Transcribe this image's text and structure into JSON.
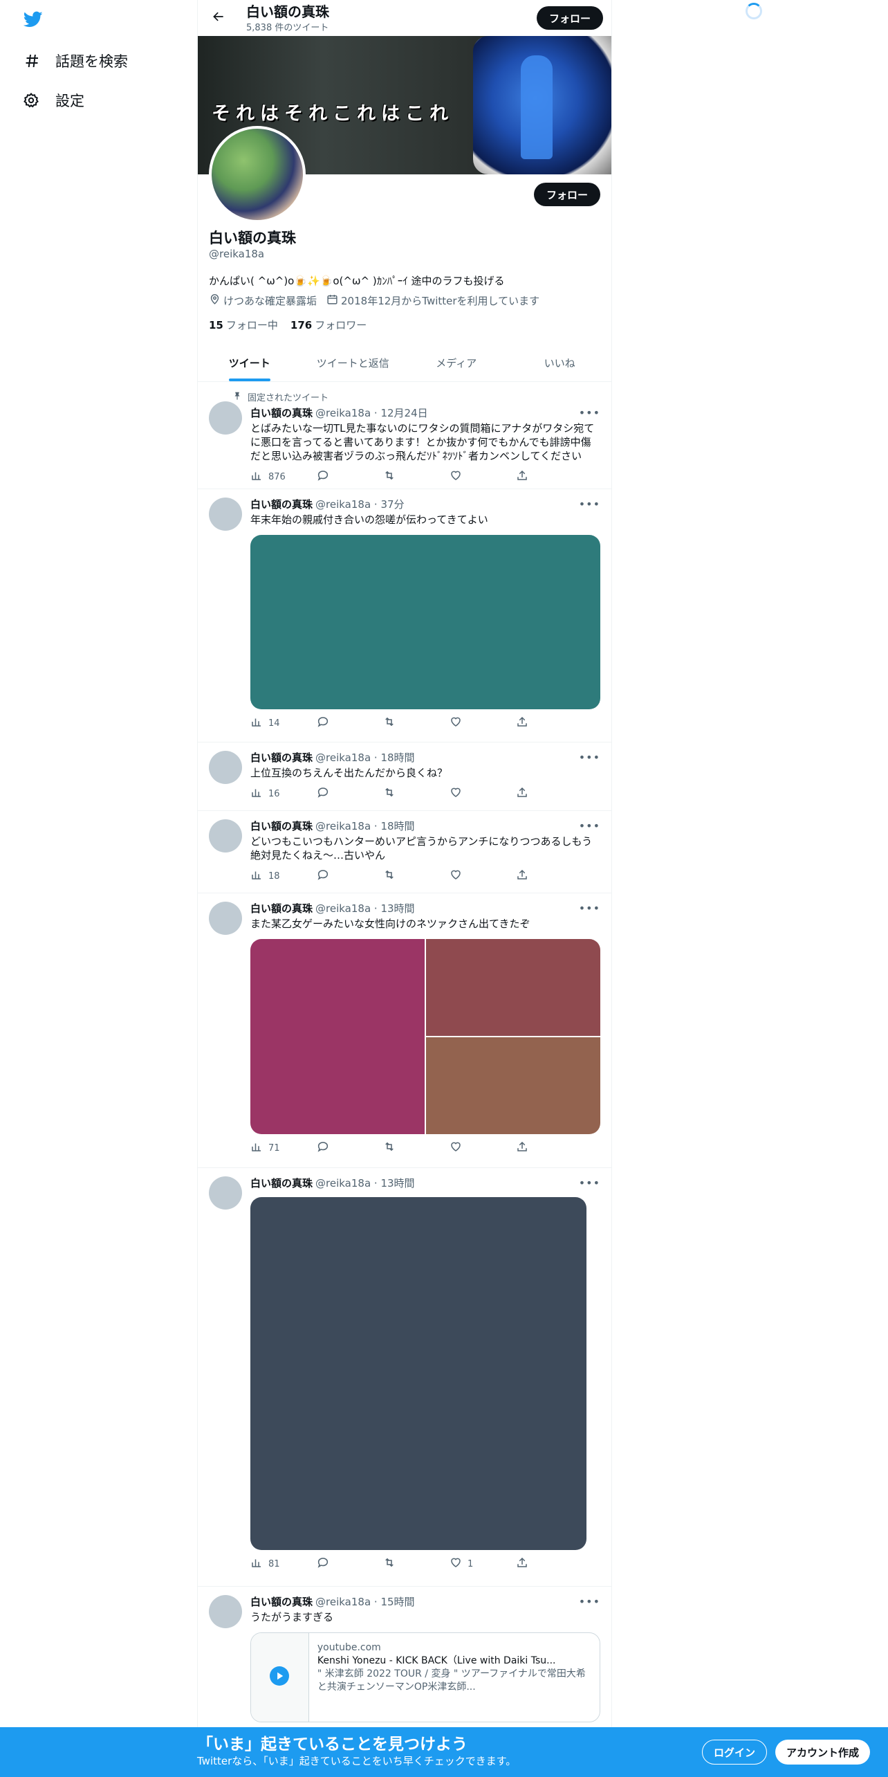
{
  "nav": {
    "items": [
      {
        "label": "話題を検索",
        "icon": "hashtag-icon"
      },
      {
        "label": "設定",
        "icon": "gear-icon"
      }
    ]
  },
  "header": {
    "name": "白い額の真珠",
    "tweet_count": "5,838 件のツイート",
    "follow_label": "フォロー"
  },
  "banner": {
    "text": "それはそれこれはこれ"
  },
  "profile": {
    "name": "白い額の真珠",
    "handle": "@reika18a",
    "bio": "かんぱい( ^ω^)o🍺✨🍺o(^ω^ )ｶﾝﾊﾟｰｲ 途中のラフも投げる",
    "location": "けつあな確定暴露垢",
    "joined": "2018年12月からTwitterを利用しています",
    "following_count": "15",
    "following_label": "フォロー中",
    "followers_count": "176",
    "followers_label": "フォロワー",
    "follow_label": "フォロー"
  },
  "tabs": [
    "ツイート",
    "ツイートと返信",
    "メディア",
    "いいね"
  ],
  "tweets": [
    {
      "pinned_label": "固定されたツイート",
      "name": "白い額の真珠",
      "handle": "@reika18a",
      "time": "12月24日",
      "text": "とばみたいな一切TL見た事ないのにワタシの質問箱にアナタがワタシ宛てに悪口を言ってると書いてあります！とか抜かす何でもかんでも誹謗中傷だと思い込み被害者ヅラのぶっ飛んだｿﾄﾞﾈﾂｿﾄﾞ者カンベンしてください",
      "views": "876",
      "likes": ""
    },
    {
      "name": "白い額の真珠",
      "handle": "@reika18a",
      "time": "37分",
      "text": "年末年始の親戚付き合いの怨嗟が伝わってきてよい",
      "media_color": "#2e7b7b",
      "views": "14",
      "likes": ""
    },
    {
      "name": "白い額の真珠",
      "handle": "@reika18a",
      "time": "18時間",
      "text": "上位互換のちえんそ出たんだから良くね？",
      "views": "16",
      "likes": ""
    },
    {
      "name": "白い額の真珠",
      "handle": "@reika18a",
      "time": "18時間",
      "text": "どいつもこいつもハンターめいアピ言うからアンチになりつつあるしもう絶対見たくねえ〜…古いやん",
      "views": "18",
      "likes": ""
    },
    {
      "name": "白い額の真珠",
      "handle": "@reika18a",
      "time": "13時間",
      "text": "また某乙女ゲーみたいな女性向けのネツァクさん出てきたぞ",
      "media_colors": [
        "#9b3565",
        "#8f4a4f",
        "#93634f"
      ],
      "views": "71",
      "likes": ""
    },
    {
      "name": "白い額の真珠",
      "handle": "@reika18a",
      "time": "13時間",
      "text": "",
      "media_color": "#3d4a5a",
      "views": "81",
      "likes": "1"
    },
    {
      "name": "白い額の真珠",
      "handle": "@reika18a",
      "time": "15時間",
      "text": "うたがうますぎる",
      "card": {
        "domain": "youtube.com",
        "title": "Kenshi Yonezu - KICK BACK（Live with Daiki Tsu...",
        "desc": "\" 米津玄師 2022 TOUR / 変身 \" ツアーファイナルで常田大希と共演チェンソーマンOP米津玄師..."
      }
    }
  ],
  "bottombar": {
    "title": "「いま」起きていることを見つけよう",
    "subtitle": "Twitterなら、「いま」起きていることをいち早くチェックできます。",
    "login": "ログイン",
    "signup": "アカウント作成"
  },
  "colors": {
    "accent": "#1d9bf0",
    "text": "#0f1419",
    "muted": "#536471"
  }
}
